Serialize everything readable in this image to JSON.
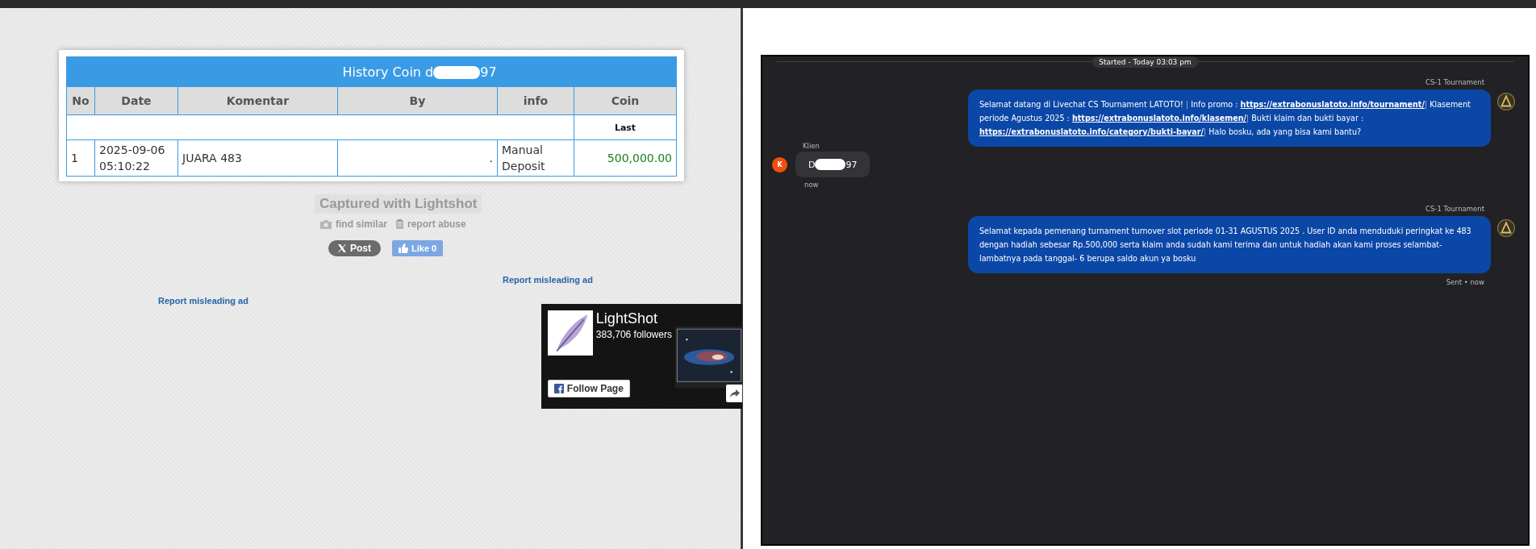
{
  "history_table": {
    "title_start": "History Coin d",
    "title_end": "97",
    "columns": [
      "No",
      "Date",
      "Komentar",
      "By",
      "info",
      "Coin"
    ],
    "subheader": "Last",
    "rows": [
      {
        "no": "1",
        "date": "2025-09-06 05:10:22",
        "komentar": "JUARA 483",
        "by": ".",
        "info": "Manual Deposit",
        "coin": "500,000.00"
      }
    ]
  },
  "lightshot": {
    "caption": "Captured with Lightshot",
    "find_similar": "find similar",
    "report_abuse": "report abuse",
    "post_button": "Post",
    "like_button": "Like 0",
    "report_ad_right": "Report misleading ad",
    "report_ad_left": "Report misleading ad"
  },
  "fb_widget": {
    "page_name": "LightShot",
    "followers": "383,706 followers",
    "follow_button": "Follow Page"
  },
  "chat": {
    "started": "Started - Today 03:03 pm",
    "messages": [
      {
        "kind": "agent",
        "sender": "CS-1 Tournament",
        "segments": [
          {
            "kind": "text",
            "text": "Selamat datang di Livechat CS Tournament LATOTO! "
          },
          {
            "kind": "bar",
            "text": "|"
          },
          {
            "kind": "text",
            "text": " Info promo : "
          },
          {
            "kind": "link",
            "text": "https://extrabonuslatoto.info/tournament/"
          },
          {
            "kind": "bar",
            "text": "|"
          },
          {
            "kind": "text",
            "text": " Klasement periode Agustus 2025 : "
          },
          {
            "kind": "link",
            "text": "https://extrabonuslatoto.info/klasemen/"
          },
          {
            "kind": "bar",
            "text": "|"
          },
          {
            "kind": "text",
            "text": " Bukti klaim dan bukti bayar : "
          },
          {
            "kind": "link",
            "text": "https://extrabonuslatoto.info/category/bukti-bayar/"
          },
          {
            "kind": "bar",
            "text": "|"
          },
          {
            "kind": "text",
            "text": " Halo bosku, ada yang bisa kami bantu?"
          }
        ]
      },
      {
        "kind": "client",
        "sender": "Klien",
        "avatar": "K",
        "text_start": "D",
        "text_end": "97",
        "time": "now"
      },
      {
        "kind": "agent",
        "sender": "CS-1 Tournament",
        "segments": [
          {
            "kind": "text",
            "text": "Selamat kepada pemenang turnament turnover slot periode 01-31 AGUSTUS 2025 . User ID anda menduduki peringkat ke 483 dengan hadiah sebesar Rp.500,000 serta klaim anda sudah kami terima dan untuk hadiah akan kami proses selambat-lambatnya pada tanggal- 6 berupa saldo akun ya bosku"
          }
        ],
        "status": "Sent",
        "separator": "•",
        "time": "now"
      }
    ]
  }
}
